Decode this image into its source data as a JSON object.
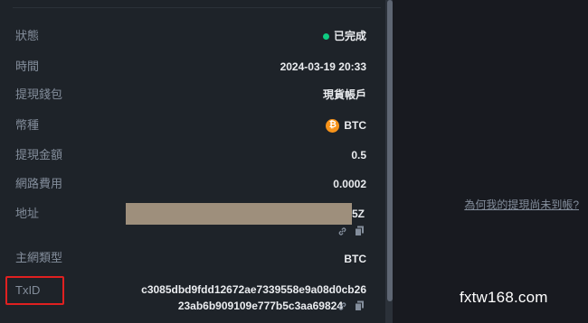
{
  "details": {
    "status_label": "狀態",
    "status_value": "已完成",
    "time_label": "時間",
    "time_value": "2024-03-19 20:33",
    "wallet_label": "提現錢包",
    "wallet_value": "現貨帳戶",
    "coin_label": "幣種",
    "coin_value": "BTC",
    "coin_icon_glyph": "₿",
    "amount_label": "提現金額",
    "amount_value": "0.5",
    "fee_label": "網路費用",
    "fee_value": "0.0002",
    "address_label": "地址",
    "address_tail": "5Z",
    "network_label": "主網類型",
    "network_value": "BTC",
    "txid_label": "TxID",
    "txid_line1": "c3085dbd9fdd12672ae7339558e9a08d0cb26",
    "txid_line2": "23ab6b909109e777b5c3aa69824"
  },
  "help_link": "為何我的提現尚未到帳?",
  "watermark": "fxtw168.com",
  "colors": {
    "status_green": "#0ecb81",
    "btc_orange": "#f7931a",
    "highlight_red": "#e02020",
    "redaction": "#9e8f7c"
  }
}
